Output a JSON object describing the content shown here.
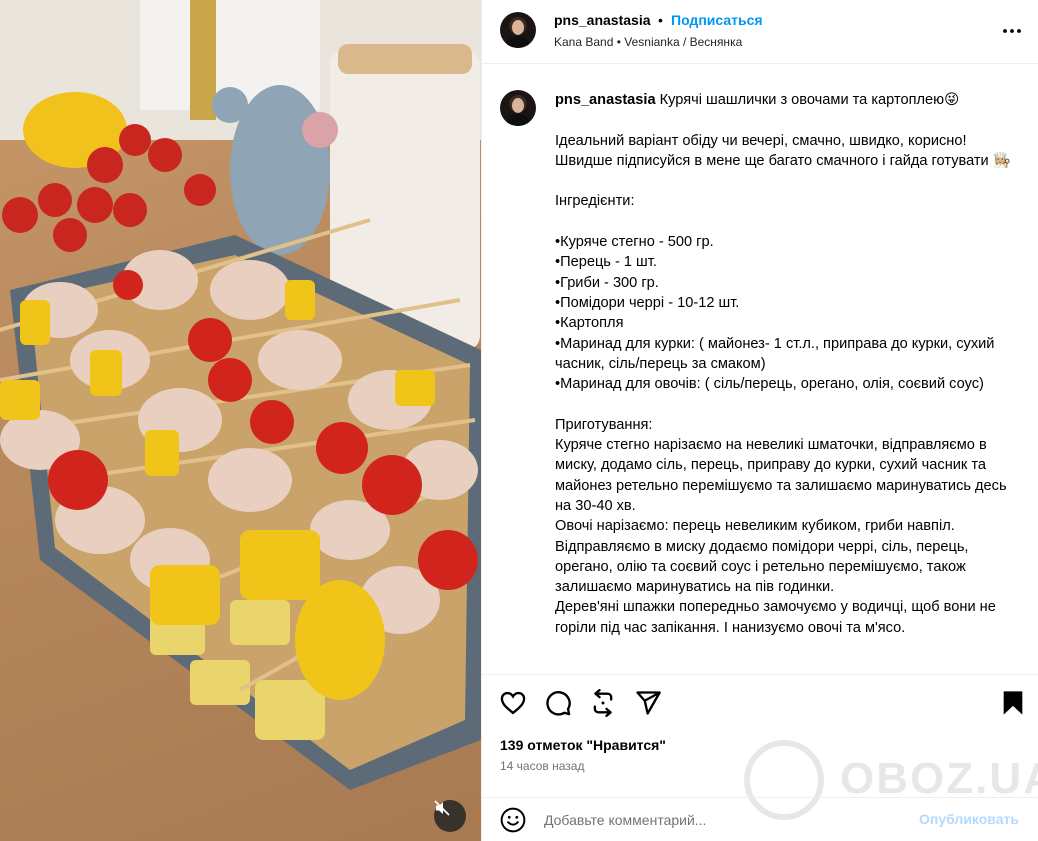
{
  "post": {
    "username": "pns_anastasia",
    "follow_label": "Подписаться",
    "separator": "•",
    "music": "Kana Band • Vesnianka / Веснянка"
  },
  "caption": {
    "username": "pns_anastasia",
    "title": "Курячі шашлички з овочами та картоплею😜",
    "lines": [
      "Ідеальний варіант обіду чи вечері, смачно, швидко, корисно! Швидше підписуйся в мене ще багато смачного і гайда готувати 👩🏼‍🍳",
      "",
      "Інгредієнти:",
      "",
      "•Куряче стегно - 500 гр.",
      "•Перець - 1 шт.",
      "•Гриби - 300 гр.",
      "•Помідори черрі - 10-12 шт.",
      "•Картопля",
      "•Маринад для курки: ( майонез- 1 ст.л., приправа до курки, сухий часник, сіль/перець за смаком)",
      "•Маринад для овочів: ( сіль/перець, орегано, олія, соєвий соус)",
      "",
      "Приготування:",
      "Куряче стегно нарізаємо на невеликі шматочки, відправляємо в миску, додамо сіль, перець, приправу до курки, сухий часник та майонез ретельно перемішуємо та залишаємо маринуватись десь на 30-40 хв.",
      "Овочі нарізаємо: перець невеликим кубиком, гриби навпіл. Відправляємо в миску додаємо помідори черрі, сіль, перець, орегано, олію та соєвий соус і ретельно перемішуємо, також залишаємо маринуватись на пів годинки.",
      "Дерев'яні шпажки попередньо замочуємо у водичці, щоб вони не горіли під час запікання. І нанизуємо овочі та м'ясо."
    ]
  },
  "engagement": {
    "likes": "139 отметок \"Нравится\"",
    "time_ago": "14 часов назад"
  },
  "comment": {
    "placeholder": "Добавьте комментарий...",
    "publish_label": "Опубликовать"
  },
  "watermark": {
    "text": "OBOZ.UA"
  },
  "icons": {
    "like": "heart-icon",
    "comment": "comment-icon",
    "repost": "repost-icon",
    "share": "share-icon",
    "save": "bookmark-icon",
    "more": "more-icon",
    "mute": "muted-speaker-icon",
    "emoji": "emoji-icon"
  },
  "colors": {
    "accent": "#0095f6",
    "publish_disabled": "#b3dbff",
    "secondary_text": "#737373",
    "divider": "#efefef"
  }
}
